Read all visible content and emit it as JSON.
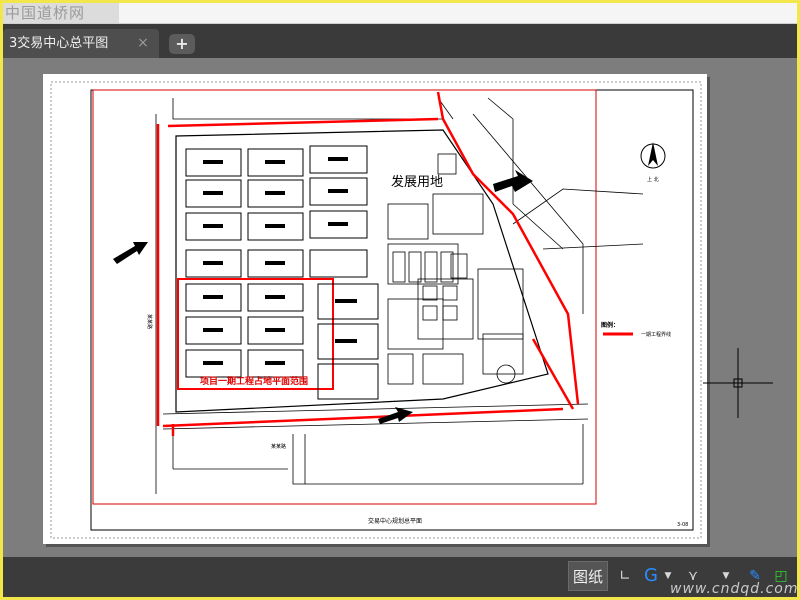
{
  "watermark": {
    "text": "中国道桥网"
  },
  "tabs": [
    {
      "label": "3交易中心总平图",
      "close": "×"
    }
  ],
  "tab_add": "+",
  "drawing": {
    "title_block": "交易中心规划总平面",
    "sheet_no": "3-08",
    "reserve_area": "发展用地",
    "phase_label": "项目一期工程占地平面范围",
    "legend_title": "图例：",
    "legend_item": "一期工程界线",
    "north_label": "上 北",
    "road_label_left": "某某路",
    "road_label_bottom": "某某路"
  },
  "statusbar": {
    "layout_button": "图纸",
    "site_watermark": "www.cndqd.com"
  },
  "colors": {
    "boundary": "#ff0000",
    "phase": "#e00000",
    "lines": "#000000",
    "app_bg": "#7b7b7b",
    "accent": "#1e90ff"
  },
  "icons": {
    "ortho": "ortho-icon",
    "polar": "polar-tracking-icon",
    "osnap": "object-snap-icon",
    "annotate": "annotation-scale-icon",
    "workspace": "workspace-icon"
  }
}
